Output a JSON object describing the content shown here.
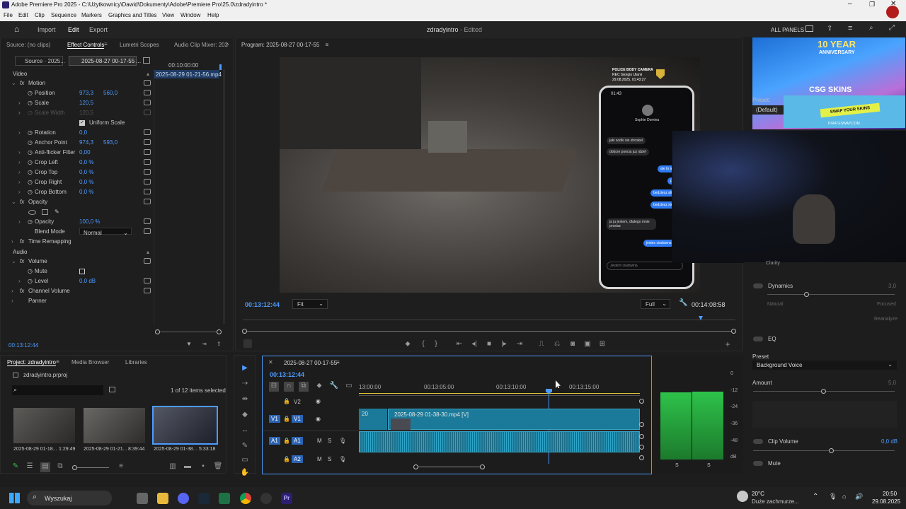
{
  "window": {
    "title": "Adobe Premiere Pro 2025 - C:\\Użytkownicy\\Dawid\\Dokumenty\\Adobe\\Premiere Pro\\25.0\\zdradyintro *"
  },
  "menu": [
    "File",
    "Edit",
    "Clip",
    "Sequence",
    "Markers",
    "Graphics and Titles",
    "View",
    "Window",
    "Help"
  ],
  "header": {
    "import": "Import",
    "edit": "Edit",
    "export": "Export",
    "project_name": "zdradyintro",
    "edited": "- Edited",
    "all_panels": "ALL PANELS"
  },
  "effect_controls": {
    "tabs": [
      "Source: (no clips)",
      "Effect Controls",
      "Lumetri Scopes",
      "Audio Clip Mixer: 202"
    ],
    "source_dd": "Source · 2025...",
    "seq_dd": "2025-08-27 00-17-55 ...",
    "ruler_time": "00:10:00:00",
    "clip_label": "2025-08-29 01-21-56.mp4",
    "video": "Video",
    "audio": "Audio",
    "props": [
      {
        "name": "Motion",
        "v1": "",
        "v2": ""
      },
      {
        "name": "Position",
        "v1": "973,3",
        "v2": "560,0"
      },
      {
        "name": "Scale",
        "v1": "120,5",
        "v2": ""
      },
      {
        "name": "Scale Width",
        "v1": "120,5",
        "v2": ""
      },
      {
        "name": "Uniform Scale",
        "v1": "",
        "v2": ""
      },
      {
        "name": "Rotation",
        "v1": "0,0",
        "v2": ""
      },
      {
        "name": "Anchor Point",
        "v1": "974,3",
        "v2": "593,0"
      },
      {
        "name": "Anti-flicker Filter",
        "v1": "0,00",
        "v2": ""
      },
      {
        "name": "Crop Left",
        "v1": "0,0 %",
        "v2": ""
      },
      {
        "name": "Crop Top",
        "v1": "0,0 %",
        "v2": ""
      },
      {
        "name": "Crop Right",
        "v1": "0,0 %",
        "v2": ""
      },
      {
        "name": "Crop Bottom",
        "v1": "0,0 %",
        "v2": ""
      },
      {
        "name": "Opacity",
        "v1": "",
        "v2": ""
      },
      {
        "name": "Opacity",
        "v1": "100,0 %",
        "v2": ""
      },
      {
        "name": "Blend Mode",
        "v1": "Normal",
        "v2": ""
      },
      {
        "name": "Time Remapping",
        "v1": "",
        "v2": ""
      },
      {
        "name": "Volume",
        "v1": "",
        "v2": ""
      },
      {
        "name": "Mute",
        "v1": "",
        "v2": ""
      },
      {
        "name": "Level",
        "v1": "0,0 dB",
        "v2": ""
      },
      {
        "name": "Channel Volume",
        "v1": "",
        "v2": ""
      },
      {
        "name": "Panner",
        "v1": "",
        "v2": ""
      }
    ],
    "timecode": "00:13:12:44"
  },
  "program": {
    "title": "Program: 2025-08-27 00-17-55",
    "timecode": "00:13:12:44",
    "fit": "Fit",
    "full": "Full",
    "duration": "00:14:08:58"
  },
  "overlay": {
    "banner_line1": "10 YEAR",
    "banner_line2": "ANNIVERSARY",
    "brand": "CSG SKINS",
    "swap": "SWAP YOUR SKINS",
    "site": "PIRATESWAP.COM",
    "preset_label": "Preset:",
    "preset_val": "(Default)"
  },
  "phone": {
    "time": "01:43",
    "contact": "Sophie Domina",
    "msgs": [
      "jaki sodki sie stroskel",
      "dobrze poncia juz idzie!",
      "ale to jer",
      "po",
      "bedziesz ali",
      "bedziesz sie",
      "ja ju jestem, dlatego mnie prosisz",
      "jestes ciudowna"
    ],
    "input": "Jestem ciudowna",
    "cam_line1": "POLICE BODY CAMERA",
    "cam_line2": "REC  Giorgio Ulanii",
    "cam_line3": "29.08.2025, 01:43:27"
  },
  "essential_sound": {
    "dynamics": "Dynamics",
    "dyn_val": "3,0",
    "natural": "Natural",
    "focused": "Focused",
    "reanalyze": "Reanalyze",
    "eq": "EQ",
    "preset": "Preset",
    "preset_val": "Background Voice",
    "amount": "Amount",
    "amount_val": "5,0",
    "clip_volume": "Clip Volume",
    "clip_vol_val": "0,0 dB",
    "mute": "Mute",
    "clarity": "Clarity"
  },
  "project": {
    "tabs": [
      "Project: zdradyintro",
      "Media Browser",
      "Libraries"
    ],
    "file": "zdradyintro.prproj",
    "selected": "1 of 12 items selected",
    "items": [
      {
        "name": "2025-08-29 01-18...",
        "dur": "1:29:49"
      },
      {
        "name": "2025-08-29 01-21...",
        "dur": "8:39:44"
      },
      {
        "name": "2025-08-29 01-38...",
        "dur": "5:33:18"
      }
    ]
  },
  "timeline": {
    "seq": "2025-08-27 00-17-55",
    "timecode": "00:13:12:44",
    "ticks": [
      "13:00:00",
      "00:13:05:00",
      "00:13:10:00",
      "00:13:15:00"
    ],
    "tracks": [
      "V2",
      "V1",
      "A1",
      "A2"
    ],
    "clip_label": "2025-08-29 01-38-30.mp4 [V]",
    "clip_small": "20"
  },
  "meter": {
    "labels": [
      "0",
      "-12",
      "-24",
      "-36",
      "-48",
      "dB"
    ],
    "channels": [
      "S",
      "S"
    ],
    "levels": [
      0.79,
      0.8
    ]
  },
  "taskbar": {
    "search": "Wyszukaj",
    "temp": "20°C",
    "weather": "Duże zachmurze...",
    "time": "20:50",
    "date": "29.08.2025"
  },
  "colors": {
    "accent": "#4d9bff",
    "clip": "#1b7a99",
    "audio": "#2a8cb3",
    "premiere": "#2a1f6e"
  }
}
